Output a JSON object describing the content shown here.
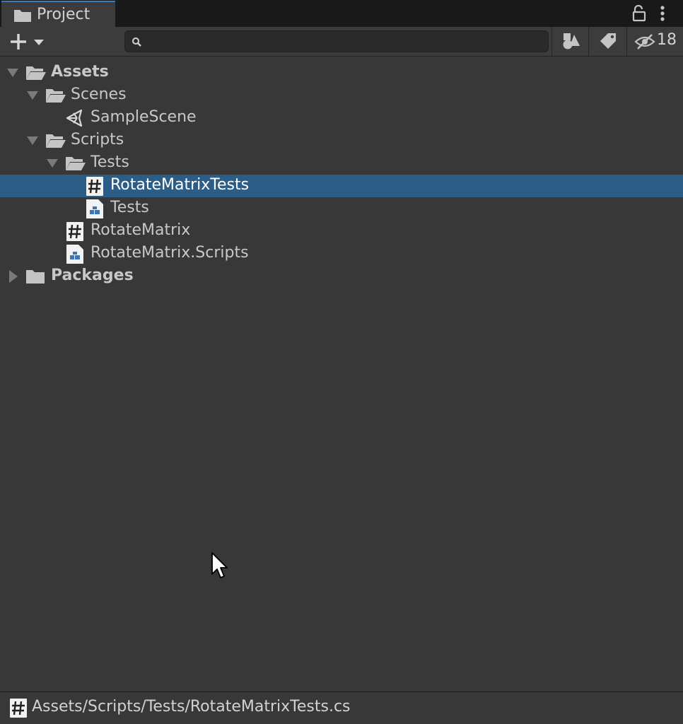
{
  "window": {
    "tab_title": "Project",
    "tab_icon": "folder-icon",
    "lock_icon": "lock-icon",
    "menu_icon": "kebab-menu-icon"
  },
  "toolbar": {
    "create_icon": "plus-dropdown-icon",
    "search": {
      "value": "",
      "placeholder": ""
    },
    "filter_by_type_icon": "shapes-icon",
    "filter_by_label_icon": "tag-icon",
    "hidden_packages_icon": "eye-slash-icon",
    "hidden_packages_count": "18"
  },
  "tree": [
    {
      "name": "Assets",
      "icon": "folder-open-icon",
      "expanded": true,
      "bold": true
    },
    {
      "name": "Scenes",
      "icon": "folder-open-icon",
      "expanded": true
    },
    {
      "name": "SampleScene",
      "icon": "unity-scene-icon"
    },
    {
      "name": "Scripts",
      "icon": "folder-open-icon",
      "expanded": true
    },
    {
      "name": "Tests",
      "icon": "folder-open-icon",
      "expanded": true
    },
    {
      "name": "RotateMatrixTests",
      "icon": "csharp-script-icon",
      "selected": true
    },
    {
      "name": "Tests",
      "icon": "assembly-definition-icon"
    },
    {
      "name": "RotateMatrix",
      "icon": "csharp-script-icon"
    },
    {
      "name": "RotateMatrix.Scripts",
      "icon": "assembly-definition-icon"
    },
    {
      "name": "Packages",
      "icon": "folder-closed-icon",
      "expanded": false,
      "bold": true
    }
  ],
  "status": {
    "icon": "csharp-script-icon",
    "path": "Assets/Scripts/Tests/RotateMatrixTests.cs"
  },
  "colors": {
    "panel_bg": "#383838",
    "tab_bar_bg": "#191919",
    "selection": "#2c5d87",
    "tab_accent": "#3a79bb"
  }
}
